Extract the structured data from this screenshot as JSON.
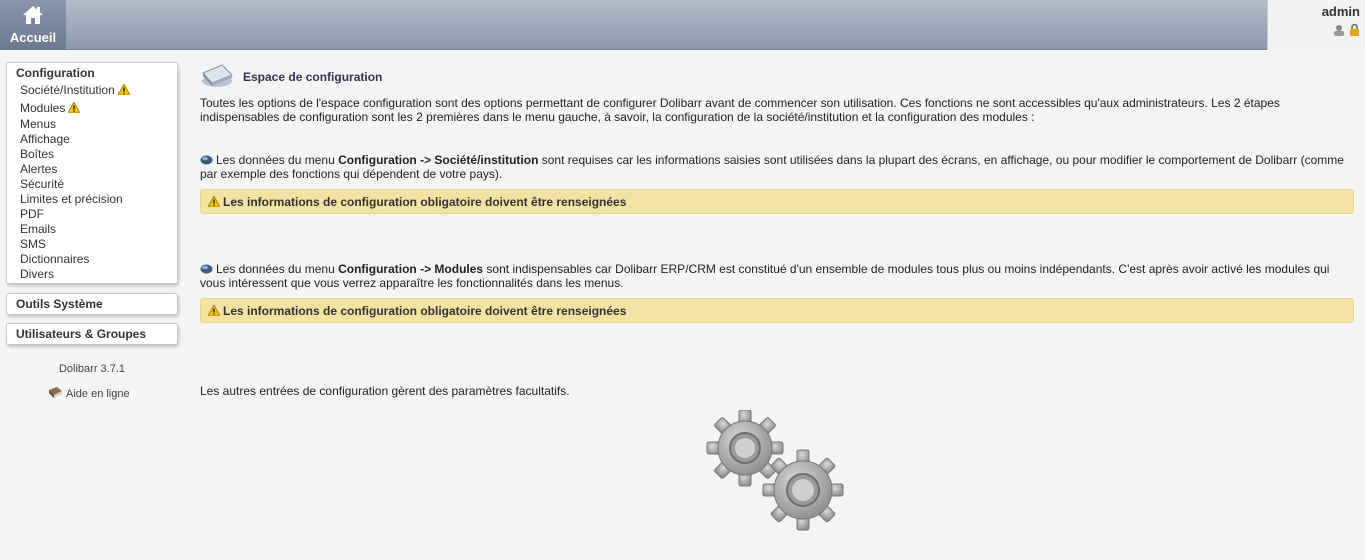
{
  "topbar": {
    "home_label": "Accueil",
    "login": "admin",
    "icons": [
      "home-icon",
      "user-icon",
      "lock-icon"
    ]
  },
  "sidebar": {
    "config_title": "Configuration",
    "items": [
      {
        "label": "Société/Institution",
        "warning": true
      },
      {
        "label": "Modules",
        "warning": true
      },
      {
        "label": "Menus"
      },
      {
        "label": "Affichage"
      },
      {
        "label": "Boîtes"
      },
      {
        "label": "Alertes"
      },
      {
        "label": "Sécurité"
      },
      {
        "label": "Limites et précision"
      },
      {
        "label": "PDF"
      },
      {
        "label": "Emails"
      },
      {
        "label": "SMS"
      },
      {
        "label": "Dictionnaires"
      },
      {
        "label": "Divers"
      }
    ],
    "outils_title": "Outils Système",
    "users_title": "Utilisateurs & Groupes",
    "version": "Dolibarr 3.7.1",
    "help_label": "Aide en ligne"
  },
  "main": {
    "title": "Espace de configuration",
    "intro": "Toutes les options de l'espace configuration sont des options permettant de configurer Dolibarr avant de commencer son utilisation. Ces fonctions ne sont accessibles qu'aux administrateurs. Les 2 étapes indispensables de configuration sont les 2 premières dans le menu gauche, à savoir, la configuration de la société/institution et la configuration des modules :",
    "step1": {
      "prefix": "Les données du menu ",
      "path": "Configuration -> Société/institution",
      "suffix": " sont requises car les informations saisies sont utilisées dans la plupart des écrans, en affichage, ou pour modifier le comportement de Dolibarr (comme par exemple des fonctions qui dépendent de votre pays)."
    },
    "step2": {
      "prefix": "Les données du menu ",
      "path": "Configuration -> Modules",
      "suffix": " sont indispensables car Dolibarr ERP/CRM est constitué d'un ensemble de modules tous plus ou moins indépendants. C'est après avoir activé les modules qui vous intéressent que vous verrez apparaître les fonctionnalités dans les menus."
    },
    "warning_text": "Les informations de configuration obligatoire doivent être renseignées",
    "footer_text": "Les autres entrées de configuration gèrent des paramètres facultatifs."
  },
  "colors": {
    "topbar": "#8d98aa",
    "warning_bg": "#f3e3a2",
    "title_text": "#333355"
  }
}
